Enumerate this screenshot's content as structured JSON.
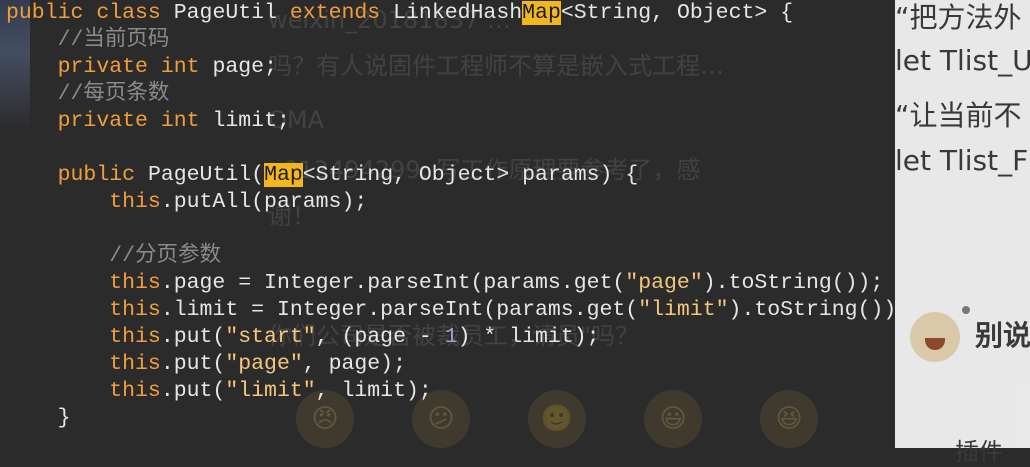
{
  "background_page": {
    "ghost_lines": [
      "weixin_20181837 …",
      "吗？有人说固件工程师不算是嵌入式工程…",
      "OMA",
      "u012494299: 写工作原理要参考了，感",
      "谢！",
      "你们公司是否被裁员工，请员\"吗？"
    ],
    "right_lines": [
      "“把方法外",
      "let Tlist_U",
      "“让当前不",
      "let Tlist_F"
    ],
    "right_heading": "别说",
    "right_footer": "插件"
  },
  "code": {
    "line1": {
      "kw1": "public",
      "kw2": "class",
      "name": "PageUtil",
      "kw3": "extends",
      "base": "LinkedHash",
      "hl": "Map",
      "generic": "<String, Object> {"
    },
    "comment_page": "//当前页码",
    "line_page": {
      "kw1": "private",
      "kw2": "int",
      "rest": "page;"
    },
    "comment_limit": "//每页条数",
    "line_limit": {
      "kw1": "private",
      "kw2": "int",
      "rest": "limit;"
    },
    "ctor": {
      "kw": "public",
      "name": "PageUtil(",
      "hl": "Map",
      "rest": "<String, Object> params) {"
    },
    "putall": {
      "kw": "this",
      "rest": ".putAll(params);"
    },
    "comment_paging": "//分页参数",
    "assign_page": {
      "kw": "this",
      "a": ".page = Integer.parseInt(params.get(",
      "str": "\"page\"",
      "b": ").toString());"
    },
    "assign_limit": {
      "kw": "this",
      "a": ".limit = Integer.parseInt(params.get(",
      "str": "\"limit\"",
      "b": ").toString());"
    },
    "put_start": {
      "kw": "this",
      "a": ".put(",
      "str": "\"start\"",
      "b": ", (page - ",
      "num": "1",
      "c": ") * limit);"
    },
    "put_page": {
      "kw": "this",
      "a": ".put(",
      "str": "\"page\"",
      "b": ", page);"
    },
    "put_limit": {
      "kw": "this",
      "a": ".put(",
      "str": "\"limit\"",
      "b": ", limit);"
    },
    "close": "}"
  },
  "emoji": [
    "😠",
    "😕",
    "🙂",
    "😃",
    "😆"
  ],
  "colors": {
    "background": "#2b2b2b",
    "keyword": "#f29d3b",
    "comment": "#8a8a8a",
    "string": "#f4c77a",
    "number": "#b294d6",
    "highlight": "#f2b61f"
  }
}
